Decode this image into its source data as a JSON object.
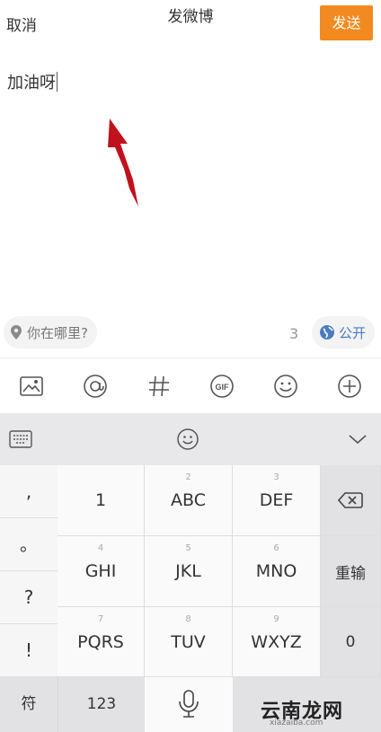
{
  "header": {
    "cancel_label": "取消",
    "title": "发微博",
    "send_label": "发送"
  },
  "compose": {
    "text": "加油呀"
  },
  "footer": {
    "location_placeholder": "你在哪里?",
    "char_count": "3",
    "visibility_label": "公开"
  },
  "toolbar": {
    "icons": [
      "image-icon",
      "at-icon",
      "hashtag-icon",
      "gif-icon",
      "emoji-icon",
      "plus-icon"
    ]
  },
  "keyboard": {
    "top_icons": [
      "keyboard-icon",
      "emoji-icon",
      "chevron-down-icon"
    ],
    "left_column": [
      ",",
      "。",
      "?",
      "!"
    ],
    "keys": [
      {
        "sup": "",
        "main": "1"
      },
      {
        "sup": "2",
        "main": "ABC"
      },
      {
        "sup": "3",
        "main": "DEF"
      },
      {
        "sup": "4",
        "main": "GHI"
      },
      {
        "sup": "5",
        "main": "JKL"
      },
      {
        "sup": "6",
        "main": "MNO"
      },
      {
        "sup": "7",
        "main": "PQRS"
      },
      {
        "sup": "8",
        "main": "TUV"
      },
      {
        "sup": "9",
        "main": "WXYZ"
      }
    ],
    "right_column": {
      "retype": "重输",
      "zero": "0"
    },
    "bottom_row": {
      "symbols": "符",
      "numbers": "123"
    }
  },
  "watermark": {
    "text": "云南龙网",
    "sub": "xiazaiba.com"
  },
  "colors": {
    "accent": "#f28a1f",
    "link": "#4a7cc2",
    "annotation": "#c0121e"
  }
}
